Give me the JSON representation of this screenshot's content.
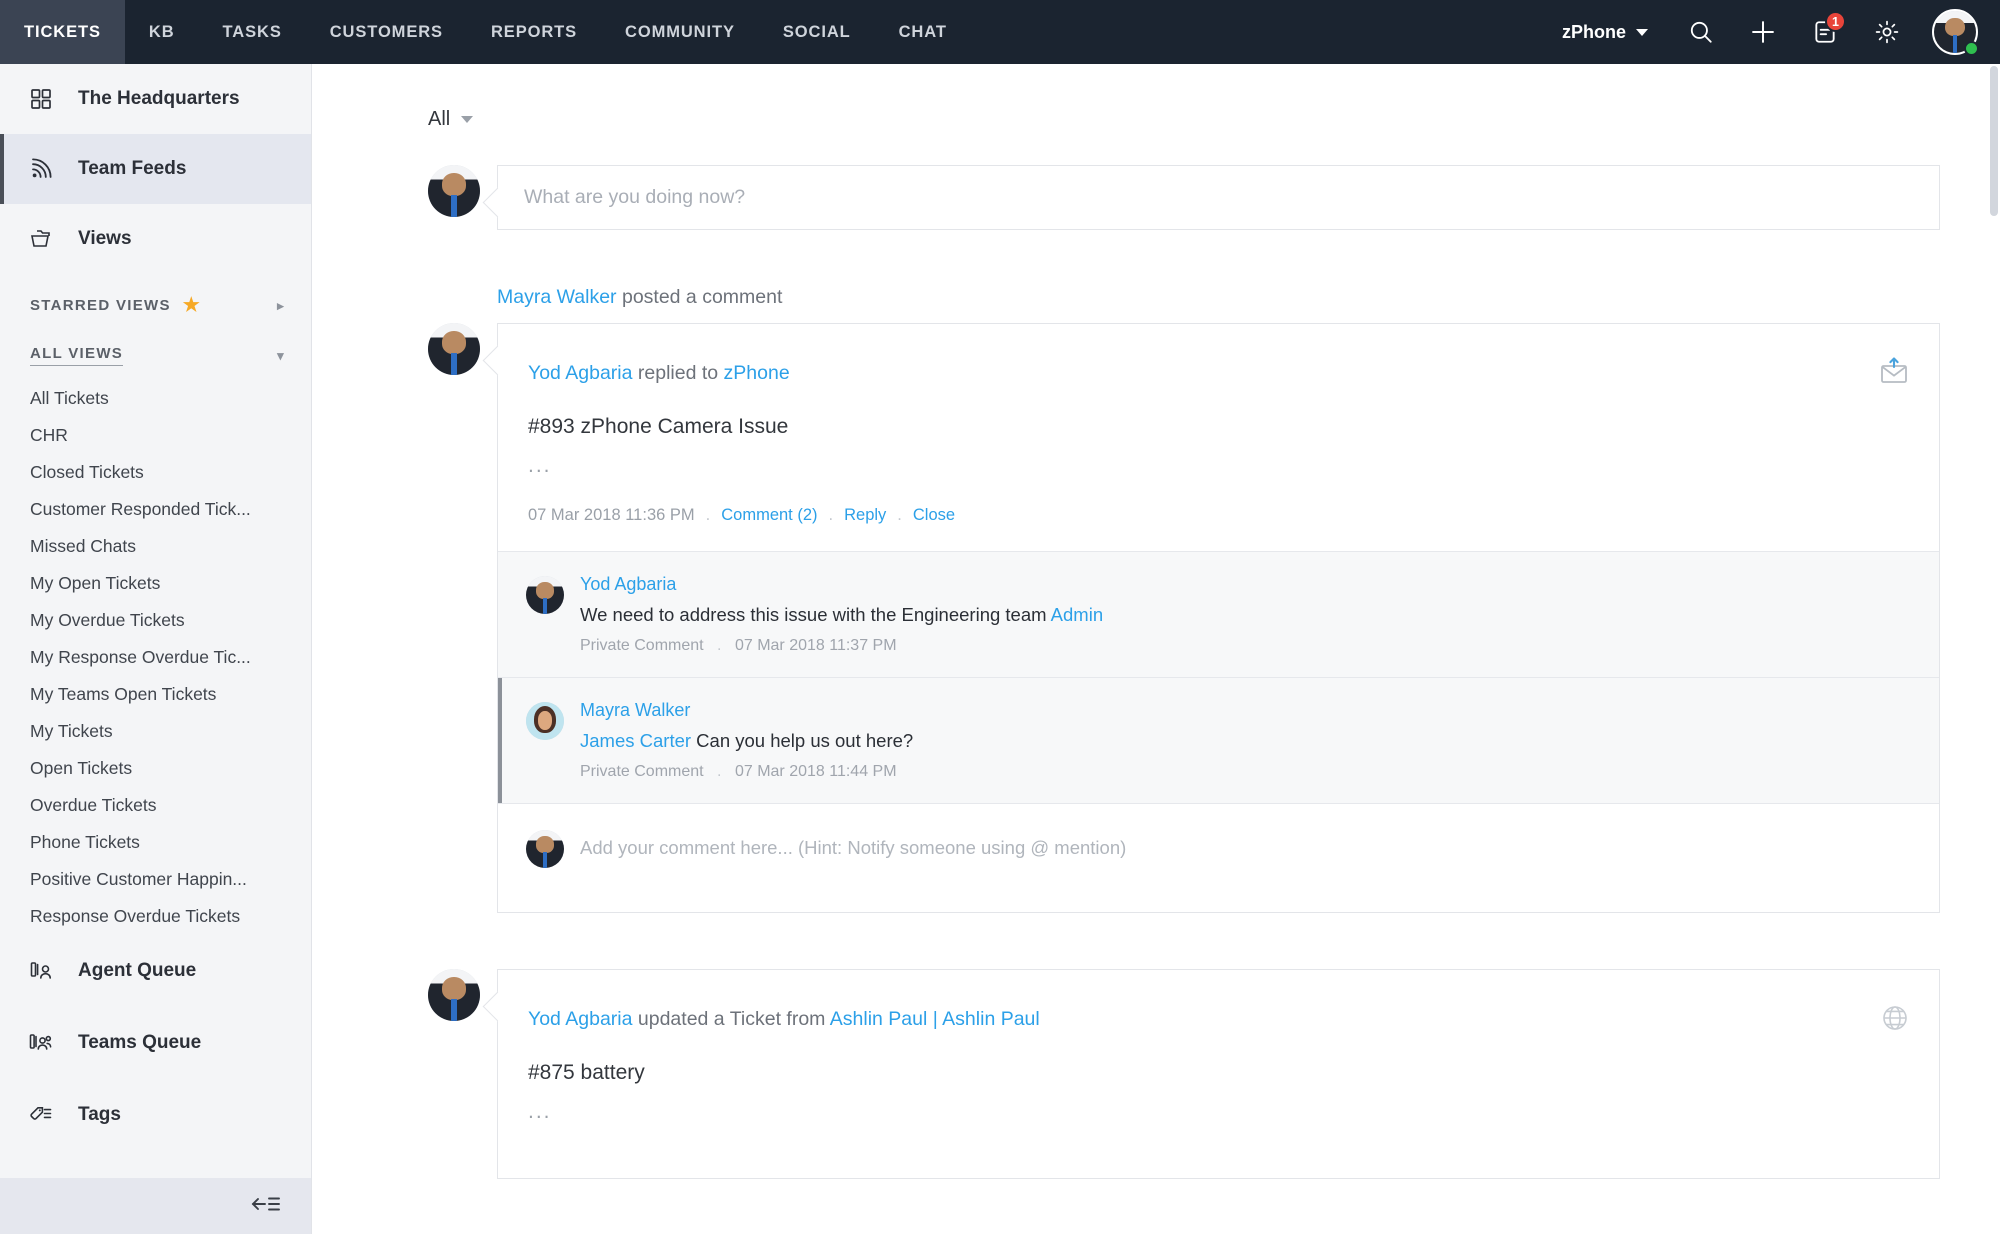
{
  "topnav": {
    "tabs": [
      {
        "label": "TICKETS",
        "active": true
      },
      {
        "label": "KB",
        "active": false
      },
      {
        "label": "TASKS",
        "active": false
      },
      {
        "label": "CUSTOMERS",
        "active": false
      },
      {
        "label": "REPORTS",
        "active": false
      },
      {
        "label": "COMMUNITY",
        "active": false
      },
      {
        "label": "SOCIAL",
        "active": false
      },
      {
        "label": "CHAT",
        "active": false
      }
    ],
    "org_name": "zPhone",
    "icons": {
      "search": "search-icon",
      "add": "plus-icon",
      "notifications": "notifications-icon",
      "settings": "gear-icon"
    },
    "notification_count": "1",
    "status": "online",
    "colors": {
      "bar_bg": "#1b2430",
      "active_tab_bg": "#3b4453",
      "badge": "#e8443a",
      "status_dot": "#2fbf4f"
    }
  },
  "sidebar": {
    "top_items": [
      {
        "label": "The Headquarters",
        "icon": "grid-icon",
        "selected": false
      },
      {
        "label": "Team Feeds",
        "icon": "feed-icon",
        "selected": true
      },
      {
        "label": "Views",
        "icon": "folders-icon",
        "selected": false
      }
    ],
    "starred_section": {
      "label": "STARRED VIEWS",
      "star": "★",
      "chevron": "▸"
    },
    "all_views_section": {
      "label": "ALL VIEWS",
      "chevron": "▾"
    },
    "views": [
      "All Tickets",
      "CHR",
      "Closed Tickets",
      "Customer Responded Tick...",
      "Missed Chats",
      "My Open Tickets",
      "My Overdue Tickets",
      "My Response Overdue Tic...",
      "My Teams Open Tickets",
      "My Tickets",
      "Open Tickets",
      "Overdue Tickets",
      "Phone Tickets",
      "Positive Customer Happin...",
      "Response Overdue Tickets"
    ],
    "bottom_items": [
      {
        "label": "Agent Queue",
        "icon": "agent-queue-icon"
      },
      {
        "label": "Teams Queue",
        "icon": "teams-queue-icon"
      },
      {
        "label": "Tags",
        "icon": "tag-icon"
      }
    ],
    "collapse_icon": "collapse-sidebar-icon"
  },
  "main": {
    "filter": {
      "label": "All"
    },
    "compose": {
      "placeholder": "What are you doing now?"
    },
    "posts": [
      {
        "header": {
          "actor": "Mayra Walker",
          "action": "posted a comment"
        },
        "channel_icon": "email-outbound-icon",
        "body_actor": "Yod Agbaria",
        "body_action": "replied to",
        "body_target": "zPhone",
        "title": "#893 zPhone Camera Issue",
        "ellipsis": "...",
        "timestamp": "07 Mar 2018 11:36 PM",
        "actions": [
          {
            "label": "Comment (2)"
          },
          {
            "label": "Reply"
          },
          {
            "label": "Close"
          }
        ],
        "comments": [
          {
            "author": "Yod Agbaria",
            "text": "We need to address this issue with the Engineering team ",
            "mention": "Admin",
            "mention_prefix": "",
            "visibility": "Private Comment",
            "timestamp": "07 Mar 2018 11:37 PM",
            "highlighted": false
          },
          {
            "author": "Mayra Walker",
            "mention_prefix": "James Carter",
            "text": " Can you help us out here?",
            "mention": "",
            "visibility": "Private Comment",
            "timestamp": "07 Mar 2018 11:44 PM",
            "highlighted": true
          }
        ],
        "comment_box_placeholder": "Add your comment here... (Hint: Notify someone using @ mention)"
      },
      {
        "header": null,
        "channel_icon": "globe-icon",
        "body_actor": "Yod Agbaria",
        "body_action": "updated a Ticket from",
        "body_target": "Ashlin Paul",
        "body_target_sep": "|",
        "body_target2": "Ashlin Paul",
        "title": "#875 battery",
        "ellipsis": "..."
      }
    ]
  },
  "colors": {
    "link": "#2ca0e8",
    "sidebar_bg": "#f4f5f7",
    "selected_bg": "#e4e7ef",
    "comment_bg": "#f7f8f9"
  }
}
